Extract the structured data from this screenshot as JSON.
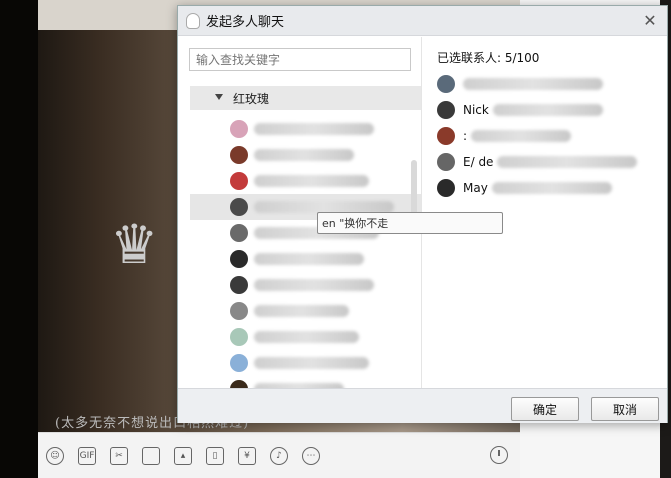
{
  "dialog": {
    "title": "发起多人聊天",
    "close_glyph": "✕",
    "search_placeholder": "输入查找关键字",
    "group_label": "红玫瑰",
    "selected_count": "已选联系人: 5/100",
    "ok_label": "确定",
    "cancel_label": "取消",
    "tooltip": "en \"换你不走"
  },
  "selected": [
    {
      "name": "Nick",
      "avatar_color": "#5a6a7a"
    },
    {
      "name": "Nick",
      "avatar_color": "#3a3a3a"
    },
    {
      "name": ":",
      "avatar_color": "#8a3a2a"
    },
    {
      "name": "E/ de",
      "avatar_color": "#666666"
    },
    {
      "name": "May",
      "avatar_color": "#2a2a2a"
    }
  ],
  "contacts": [
    {
      "avatar_color": "#d8a3b8",
      "selected": false
    },
    {
      "avatar_color": "#7a3a2a",
      "selected": false
    },
    {
      "avatar_color": "#c33b3b",
      "selected": false
    },
    {
      "avatar_color": "#4a4a4a",
      "selected": true
    },
    {
      "avatar_color": "#6a6a6a",
      "selected": false
    },
    {
      "avatar_color": "#2a2a2a",
      "selected": false
    },
    {
      "avatar_color": "#3a3a3a",
      "selected": false
    },
    {
      "avatar_color": "#888888",
      "selected": false
    },
    {
      "avatar_color": "#a8c8b8",
      "selected": false
    },
    {
      "avatar_color": "#8ab0d8",
      "selected": false
    },
    {
      "avatar_color": "#3a2a1a",
      "selected": false
    }
  ],
  "background": {
    "signature": "(太多无奈不想说出口相然难过)"
  },
  "toolbar": {
    "icons": [
      "smile-icon",
      "gif-icon",
      "scissors-icon",
      "folder-icon",
      "image-icon",
      "phone-shake-icon",
      "red-packet-icon",
      "music-icon",
      "more-icon"
    ],
    "gif_text": "GIF"
  }
}
